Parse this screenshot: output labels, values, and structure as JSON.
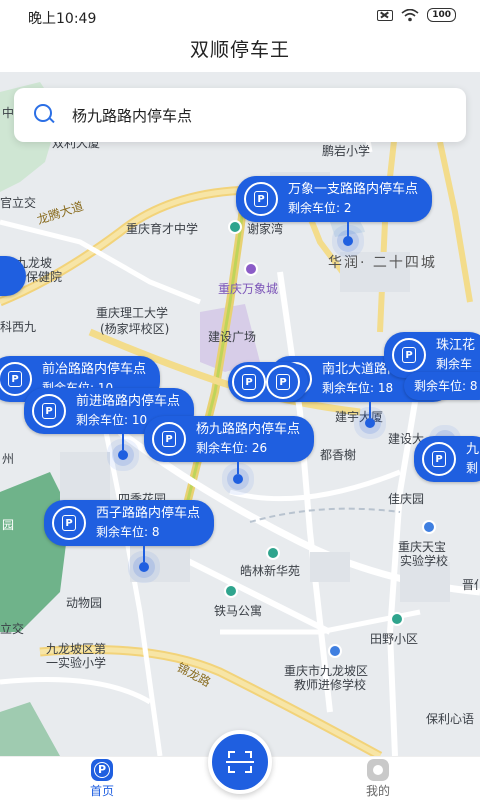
{
  "status_bar": {
    "time": "晚上10:49",
    "battery": "100"
  },
  "header": {
    "title": "双顺停车王"
  },
  "search": {
    "text": "杨九路路内停车点"
  },
  "map_labels": {
    "pengyan": "鹏岩小学",
    "guanzhi": "官立交",
    "longteng": "龙腾大道",
    "yucai": "重庆育才中学",
    "xiejiawan": "谢家湾",
    "jiulongpo": "九龙坡",
    "baojianyuan": "保健院",
    "huarun": "华润· 二十四城",
    "wanxiang": "重庆万象城",
    "ligong": "重庆理工大学",
    "yangjiaping": "(杨家坪校区)",
    "jianshe": "建设广场",
    "kexi": "科西九",
    "jianshedadao": "建设大",
    "duhui": "都香榭",
    "jianshe_tower": "建宇大厦",
    "sijihuayuan": "四季花园",
    "jiayuan": "佳庆园",
    "tianbao": "重庆天宝",
    "shiyan": "实验学校",
    "jinji": "晋仆",
    "haolin": "皓林新华苑",
    "tiema": "铁马公寓",
    "dongwuyuan": "动物园",
    "tianye": "田野小区",
    "jiulong_school1": "九龙坡区第",
    "jiulong_school2": "一实验小学",
    "jinlong": "锦龙路",
    "jinxiu1": "重庆市九龙坡区",
    "jinxiu2": "教师进修学校",
    "baoli": "保利心语",
    "yuan": "园",
    "jiaotong": "立交",
    "zhou": "州",
    "zhongyi": "中门",
    "shuangli": "双利大厦"
  },
  "markers": [
    {
      "name": "万象一支路路内停车点",
      "avail": "剩余车位: 2"
    },
    {
      "name": "前冶路路内停车点",
      "avail": "剩余车位: 10"
    },
    {
      "name": "前进路路内停车点",
      "avail": "剩余车位: 10"
    },
    {
      "name": "南北大道路内停车点",
      "avail": "剩余车位: 18"
    },
    {
      "name": "杨九路路内停车点",
      "avail": "剩余车位: 26"
    },
    {
      "name": "西子路路内停车点",
      "avail": "剩余车位: 8"
    },
    {
      "name": "珠江花",
      "avail": "剩余车"
    },
    {
      "name": "",
      "avail": "剩余车位: 8"
    },
    {
      "name": "九",
      "avail": "剩"
    }
  ],
  "tabs": {
    "home": "首页",
    "mine": "我的"
  },
  "colors": {
    "accent": "#1f5fe0",
    "park": "#3d9f5e"
  }
}
